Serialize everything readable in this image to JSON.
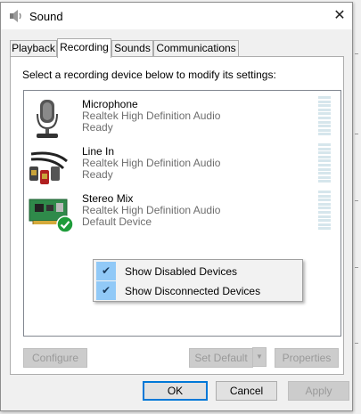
{
  "window": {
    "title": "Sound",
    "close_glyph": "✕"
  },
  "tabs": [
    {
      "label": "Playback",
      "active": false
    },
    {
      "label": "Recording",
      "active": true
    },
    {
      "label": "Sounds",
      "active": false
    },
    {
      "label": "Communications",
      "active": false
    }
  ],
  "instruction": "Select a recording device below to modify its settings:",
  "devices": [
    {
      "name": "Microphone",
      "driver": "Realtek High Definition Audio",
      "status": "Ready",
      "icon": "microphone-icon"
    },
    {
      "name": "Line In",
      "driver": "Realtek High Definition Audio",
      "status": "Ready",
      "icon": "line-in-cable-icon"
    },
    {
      "name": "Stereo Mix",
      "driver": "Realtek High Definition Audio",
      "status": "Default Device",
      "icon": "sound-card-icon",
      "default_badge": "green-check-icon"
    }
  ],
  "context_menu": {
    "items": [
      {
        "label": "Show Disabled Devices",
        "checked": true,
        "check_glyph": "✔"
      },
      {
        "label": "Show Disconnected Devices",
        "checked": true,
        "check_glyph": "✔"
      }
    ]
  },
  "buttons": {
    "configure": "Configure",
    "set_default": "Set Default",
    "set_default_arrow": "▼",
    "properties": "Properties",
    "ok": "OK",
    "cancel": "Cancel",
    "apply": "Apply"
  },
  "colors": {
    "accent": "#0078d7",
    "menu_check_bg": "#91c9f7",
    "default_badge": "#1e9c3a"
  }
}
